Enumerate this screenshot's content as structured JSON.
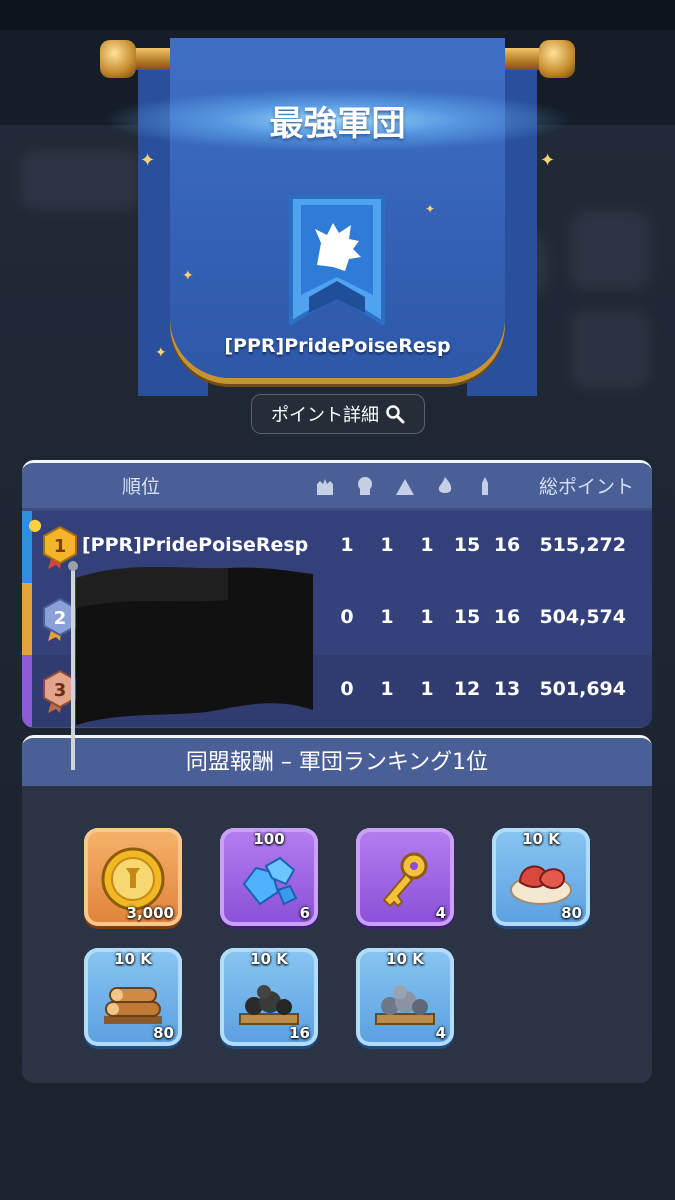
{
  "banner": {
    "title": "最強軍団",
    "alliance_name": "[PPR]PridePoiseResp",
    "points_button": "ポイント詳細"
  },
  "ranking": {
    "header": {
      "rank": "順位",
      "total": "総ポイント",
      "column_icons": [
        "fortress-icon",
        "skull-icon",
        "camp-icon",
        "flame-icon",
        "tower-icon"
      ]
    },
    "rows": [
      {
        "rank": "1",
        "name": "[PPR]PridePoiseResp",
        "values": [
          "1",
          "1",
          "1",
          "15",
          "16"
        ],
        "total": "515,272"
      },
      {
        "rank": "2",
        "name": "",
        "values": [
          "0",
          "1",
          "1",
          "15",
          "16"
        ],
        "total": "504,574"
      },
      {
        "rank": "3",
        "name": "",
        "values": [
          "0",
          "1",
          "1",
          "12",
          "13"
        ],
        "total": "501,694"
      }
    ]
  },
  "rewards": {
    "header": "同盟報酬 – 軍団ランキング1位",
    "items": [
      {
        "icon": "gold-medal-coin-icon",
        "top": "",
        "qty": "3,000",
        "frame": "orange"
      },
      {
        "icon": "blue-gems-icon",
        "top": "100",
        "qty": "6",
        "frame": "purple"
      },
      {
        "icon": "gold-key-icon",
        "top": "",
        "qty": "4",
        "frame": "purple"
      },
      {
        "icon": "meat-platter-icon",
        "top": "10 K",
        "qty": "80",
        "frame": "blue"
      },
      {
        "icon": "wood-logs-icon",
        "top": "10 K",
        "qty": "80",
        "frame": "blue"
      },
      {
        "icon": "coal-pile-icon",
        "top": "10 K",
        "qty": "16",
        "frame": "blue"
      },
      {
        "icon": "iron-ore-icon",
        "top": "10 K",
        "qty": "4",
        "frame": "blue"
      }
    ]
  },
  "colors": {
    "banner_blue": "#3562b6",
    "gold_trim": "#c79433",
    "rank_panel": "#3c4d80",
    "rank1_stripe": "#2e8fe0",
    "rank2_stripe": "#e3a33a",
    "rank3_stripe": "#8d5bd8"
  }
}
